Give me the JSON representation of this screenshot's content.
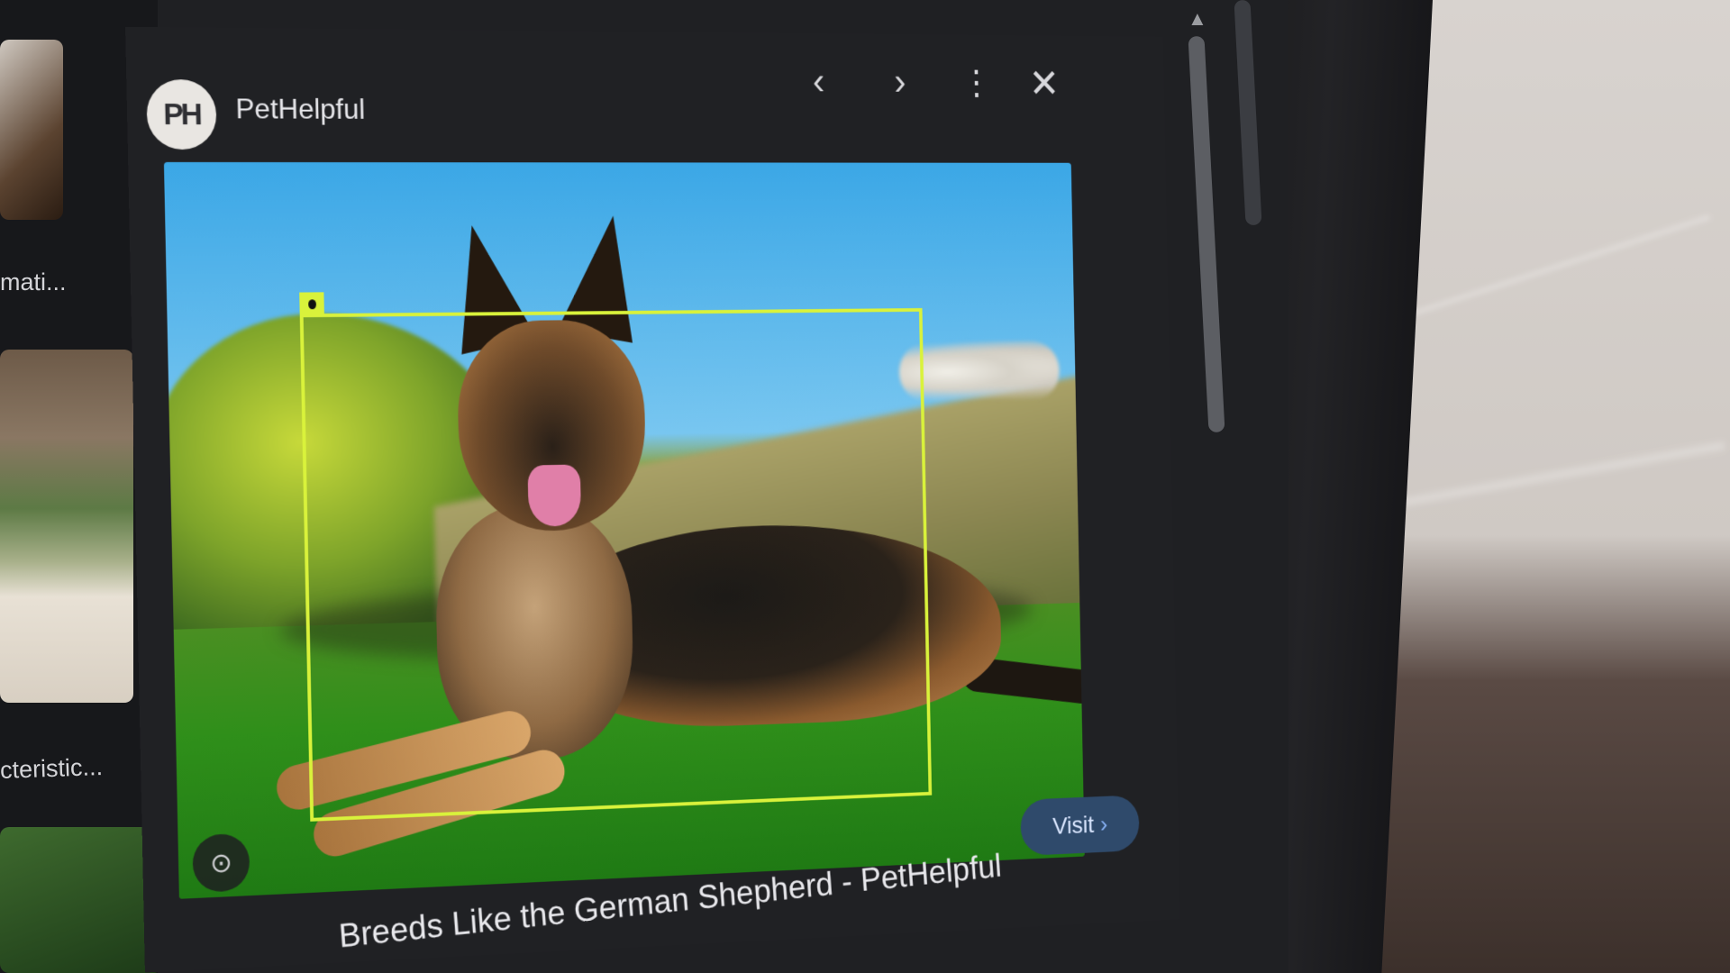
{
  "side_panel": {
    "captions": [
      "mati...",
      "cteristic..."
    ]
  },
  "viewer": {
    "site_name": "PetHelpful",
    "logo_text": "PH",
    "icons": {
      "prev": "chevron-left-icon",
      "next": "chevron-right-icon",
      "more": "more-vert-icon",
      "close": "close-icon",
      "lens": "lens-icon"
    },
    "visit_label": "Visit",
    "page_title": "Breeds Like the German Shepherd - PetHelpful"
  },
  "colors": {
    "detection_box": "#d9f23b",
    "visit_button_bg": "#2f4a6b",
    "visit_chevron": "#8ab4f8",
    "viewer_bg": "#202124"
  }
}
